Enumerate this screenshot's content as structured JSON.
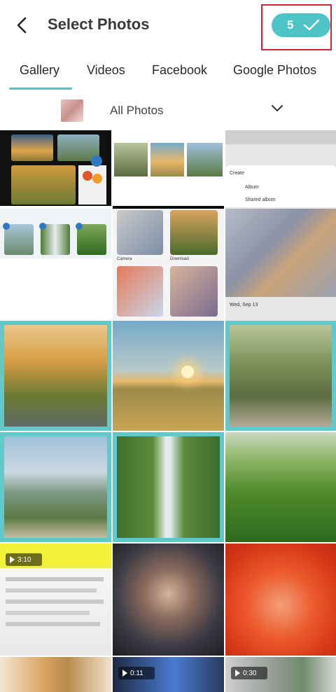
{
  "header": {
    "title": "Select Photos",
    "selected_count": "5"
  },
  "tabs": [
    {
      "label": "Gallery",
      "active": true
    },
    {
      "label": "Videos",
      "active": false
    },
    {
      "label": "Facebook",
      "active": false
    },
    {
      "label": "Google Photos",
      "active": false
    }
  ],
  "album": {
    "name": "All Photos"
  },
  "menu_overlay": {
    "heading": "Create",
    "items": [
      "Album",
      "Shared album"
    ],
    "date": "Wed, Sep 13"
  },
  "folders": [
    "Camera",
    "Download"
  ],
  "videos": [
    {
      "duration": "3:10"
    },
    {
      "duration": "0:11"
    },
    {
      "duration": "0:30"
    }
  ],
  "colors": {
    "accent": "#4ec4c8",
    "highlight_border": "#d9232e",
    "selection_border": "#62c9cb"
  },
  "icons": {
    "back": "back-arrow-icon",
    "confirm": "checkmark-icon",
    "album_chevron": "chevron-down-icon"
  }
}
